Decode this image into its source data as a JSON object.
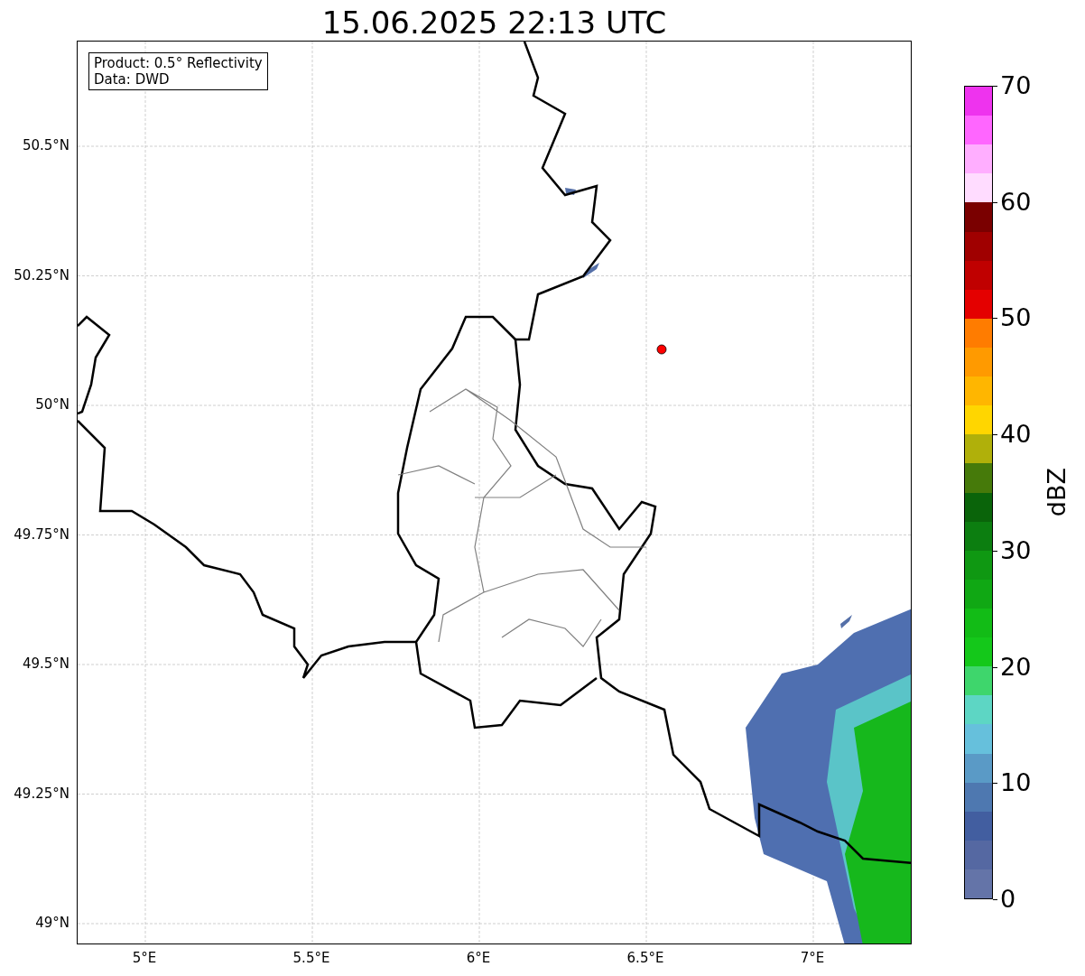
{
  "title": "15.06.2025 22:13 UTC",
  "map": {
    "legend": [
      "Product: 0.5° Reflectivity",
      "Data: DWD"
    ],
    "y_ticks": [
      "50.5°N",
      "50.25°N",
      "50°N",
      "49.75°N",
      "49.5°N",
      "49.25°N",
      "49°N"
    ],
    "x_ticks": [
      "5°E",
      "5.5°E",
      "6°E",
      "6.5°E",
      "7°E"
    ]
  },
  "colorbar": {
    "label": "dBZ",
    "ticks": [
      "70",
      "60",
      "50",
      "40",
      "30",
      "20",
      "10",
      "0"
    ],
    "segments": [
      {
        "color": "#ee33ee"
      },
      {
        "color": "#ff66ff"
      },
      {
        "color": "#ffaeff"
      },
      {
        "color": "#ffdcff"
      },
      {
        "color": "#7a0000"
      },
      {
        "color": "#a00000"
      },
      {
        "color": "#c00000"
      },
      {
        "color": "#e40000"
      },
      {
        "color": "#ff7c00"
      },
      {
        "color": "#ff9a00"
      },
      {
        "color": "#ffb600"
      },
      {
        "color": "#ffd600"
      },
      {
        "color": "#b0b00a"
      },
      {
        "color": "#467a0a"
      },
      {
        "color": "#0a640a"
      },
      {
        "color": "#0c7e10"
      },
      {
        "color": "#0f9812"
      },
      {
        "color": "#10a814"
      },
      {
        "color": "#12bc16"
      },
      {
        "color": "#14c81a"
      },
      {
        "color": "#3ed66c"
      },
      {
        "color": "#5dd6c4"
      },
      {
        "color": "#66c0dc"
      },
      {
        "color": "#5a9ac6"
      },
      {
        "color": "#4e78b0"
      },
      {
        "color": "#425ea0"
      },
      {
        "color": "#5568a2"
      },
      {
        "color": "#6474a8"
      }
    ]
  }
}
